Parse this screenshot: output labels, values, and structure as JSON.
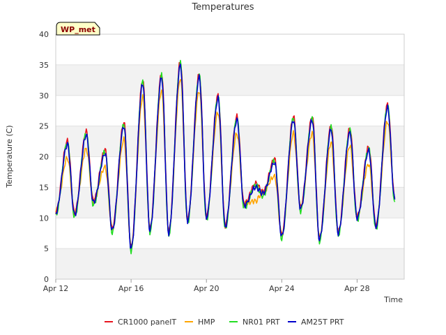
{
  "chart_data": {
    "type": "line",
    "title": "Temperatures",
    "xlabel": "Time",
    "ylabel": "Temperature (C)",
    "badge": "WP_met",
    "xlim": [
      12.0,
      30.5
    ],
    "ylim": [
      0,
      40
    ],
    "yticks": [
      0,
      5,
      10,
      15,
      20,
      25,
      30,
      35,
      40
    ],
    "xticks": [
      {
        "value": 12,
        "label": "Apr 12"
      },
      {
        "value": 16,
        "label": "Apr 16"
      },
      {
        "value": 20,
        "label": "Apr 20"
      },
      {
        "value": 24,
        "label": "Apr 24"
      },
      {
        "value": 28,
        "label": "Apr 28"
      }
    ],
    "grid": true,
    "legend_position": "bottom",
    "daily_extremes": {
      "days": [
        12,
        13,
        14,
        15,
        16,
        17,
        18,
        19,
        20,
        21,
        22,
        23,
        24,
        25,
        26,
        27,
        28,
        29
      ],
      "min": [
        10.8,
        10.5,
        12.5,
        8.0,
        5.0,
        8.0,
        7.5,
        9.5,
        10.0,
        8.5,
        12.0,
        14.0,
        7.0,
        11.5,
        6.5,
        7.5,
        10.0,
        8.5
      ],
      "max": [
        22.0,
        23.5,
        20.5,
        25.0,
        32.0,
        33.0,
        35.0,
        33.0,
        29.5,
        26.0,
        15.0,
        19.0,
        26.0,
        26.0,
        24.5,
        24.0,
        21.0,
        28.0
      ],
      "end": {
        "day": 30.0,
        "value": 13.0
      }
    },
    "series": [
      {
        "name": "CR1000 panelT",
        "color": "#e8141e",
        "max_offset": 0.6,
        "min_offset": 0.2
      },
      {
        "name": "HMP",
        "color": "#ffa500",
        "max_offset": -2.2,
        "min_offset": 0.3
      },
      {
        "name": "NR01 PRT",
        "color": "#22dd22",
        "max_offset": 0.3,
        "min_offset": -0.4
      },
      {
        "name": "AM25T PRT",
        "color": "#0000cc",
        "max_offset": 0.0,
        "min_offset": 0.0
      }
    ]
  }
}
